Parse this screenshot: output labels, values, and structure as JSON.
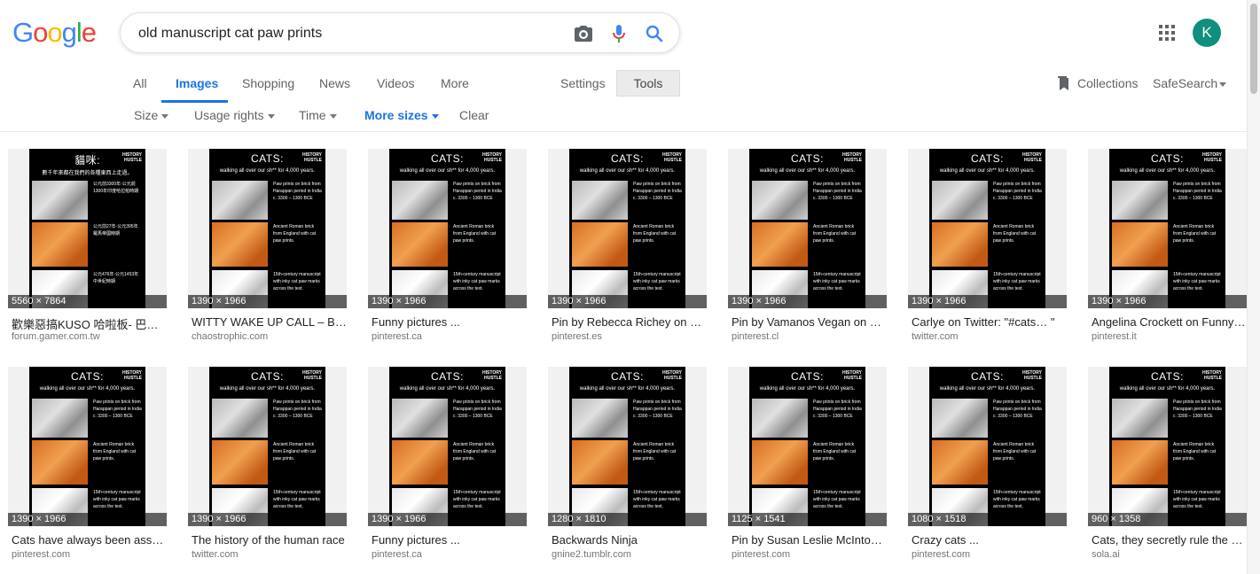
{
  "logo": {
    "letters": [
      "G",
      "o",
      "o",
      "g",
      "l",
      "e"
    ],
    "colors": [
      "#4285f4",
      "#ea4335",
      "#fbbc05",
      "#4285f4",
      "#34a853",
      "#ea4335"
    ]
  },
  "search": {
    "query": "old manuscript cat paw prints",
    "icons": [
      "camera-icon",
      "microphone-icon",
      "search-icon"
    ]
  },
  "user": {
    "avatar_letter": "K",
    "avatar_color": "#0f8f7d"
  },
  "nav": {
    "tabs": [
      {
        "label": "All",
        "active": false
      },
      {
        "label": "Images",
        "active": true
      },
      {
        "label": "Shopping",
        "active": false
      },
      {
        "label": "News",
        "active": false
      },
      {
        "label": "Videos",
        "active": false
      },
      {
        "label": "More",
        "active": false
      }
    ],
    "settings_label": "Settings",
    "tools_label": "Tools",
    "collections_label": "Collections",
    "safesearch_label": "SafeSearch"
  },
  "filters": {
    "size": "Size",
    "usage_rights": "Usage rights",
    "time": "Time",
    "more_sizes": "More sizes",
    "clear": "Clear"
  },
  "poster": {
    "title": "CATS:",
    "subtitle": "walking all over our sh** for 4,000 years.",
    "badge_line1": "HISTORY",
    "badge_line2": "HUSTLE",
    "caption1": "Paw prints on brick from Harappan period in India c. 3300 – 1300 BCE",
    "caption2": "Ancient Roman brick from England with cat paw prints.",
    "caption3": "15th-century manuscript with inky cat paw marks across the text.",
    "cn_title": "貓咪:",
    "cn_subtitle": "數千年來都在我們的各種東西上走過。",
    "cn_caption1": "公元前3300年-公元前1300年印度哈拉帕時期",
    "cn_caption2": "公元前27年-公元395年羅馬帝國時期",
    "cn_caption3": "公元476年-公元1453年中世紀時期"
  },
  "results": [
    {
      "dims": "5560 × 7864",
      "title": "歡樂惡搞KUSO 哈啦板- 巴哈姆特",
      "site": "forum.gamer.com.tw",
      "variant": "cn"
    },
    {
      "dims": "1390 × 1966",
      "title": "WITTY WAKE UP CALL – BIG BROTHER",
      "site": "chaostrophic.com",
      "variant": "en"
    },
    {
      "dims": "1390 × 1966",
      "title": "Funny pictures ...",
      "site": "pinterest.ca",
      "variant": "en"
    },
    {
      "dims": "1390 × 1966",
      "title": "Pin by Rebecca Richey on giggles",
      "site": "pinterest.es",
      "variant": "en"
    },
    {
      "dims": "1390 × 1966",
      "title": "Pin by Vamanos Vegan on Cats",
      "site": "pinterest.cl",
      "variant": "en"
    },
    {
      "dims": "1390 × 1966",
      "title": "Carlye on Twitter: \"#cats… \"",
      "site": "twitter.com",
      "variant": "en"
    },
    {
      "dims": "1390 × 1966",
      "title": "Angelina Crockett on Funny kitties",
      "site": "pinterest.it",
      "variant": "en"
    },
    {
      "dims": "1390 × 1966",
      "title": "Cats have always been assholes",
      "site": "pinterest.com",
      "variant": "en"
    },
    {
      "dims": "1390 × 1966",
      "title": "The history of the human race",
      "site": "twitter.com",
      "variant": "en"
    },
    {
      "dims": "1390 × 1966",
      "title": "Funny pictures ...",
      "site": "pinterest.ca",
      "variant": "en"
    },
    {
      "dims": "1280 × 1810",
      "title": "Backwards Ninja",
      "site": "gnine2.tumblr.com",
      "variant": "en"
    },
    {
      "dims": "1125 × 1541",
      "title": "Pin by Susan Leslie McIntosh on Cats",
      "site": "pinterest.com",
      "variant": "en"
    },
    {
      "dims": "1080 × 1518",
      "title": "Crazy cats ...",
      "site": "pinterest.com",
      "variant": "en"
    },
    {
      "dims": "960 × 1358",
      "title": "Cats, they secretly rule the world",
      "site": "sola.ai",
      "variant": "en"
    }
  ]
}
